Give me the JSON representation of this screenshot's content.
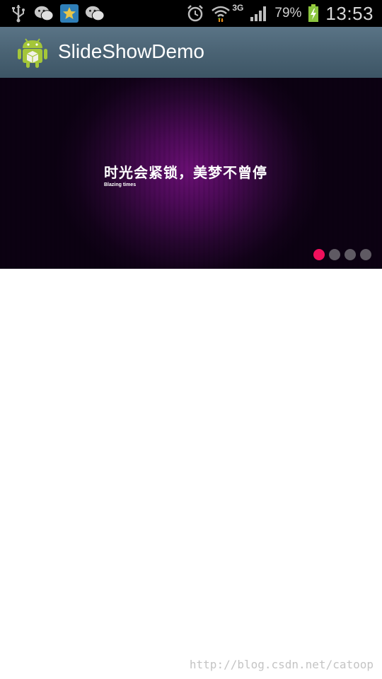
{
  "status_bar": {
    "left_icons": [
      "usb-icon",
      "wechat-icon",
      "star-app-icon",
      "wechat-icon"
    ],
    "network_type": "3G",
    "battery_percent": "79%",
    "time": "13:53"
  },
  "action_bar": {
    "title": "SlideShowDemo",
    "icon": "android-icon"
  },
  "slideshow": {
    "title": "时光会紧锁，美梦不曾停",
    "subtitle": "Blazing times",
    "total_slides": 4,
    "active_slide": 1,
    "colors": {
      "active_dot": "#f0105c",
      "inactive_dot": "#5f5a63"
    }
  },
  "watermark": "http://blog.csdn.net/catoop"
}
